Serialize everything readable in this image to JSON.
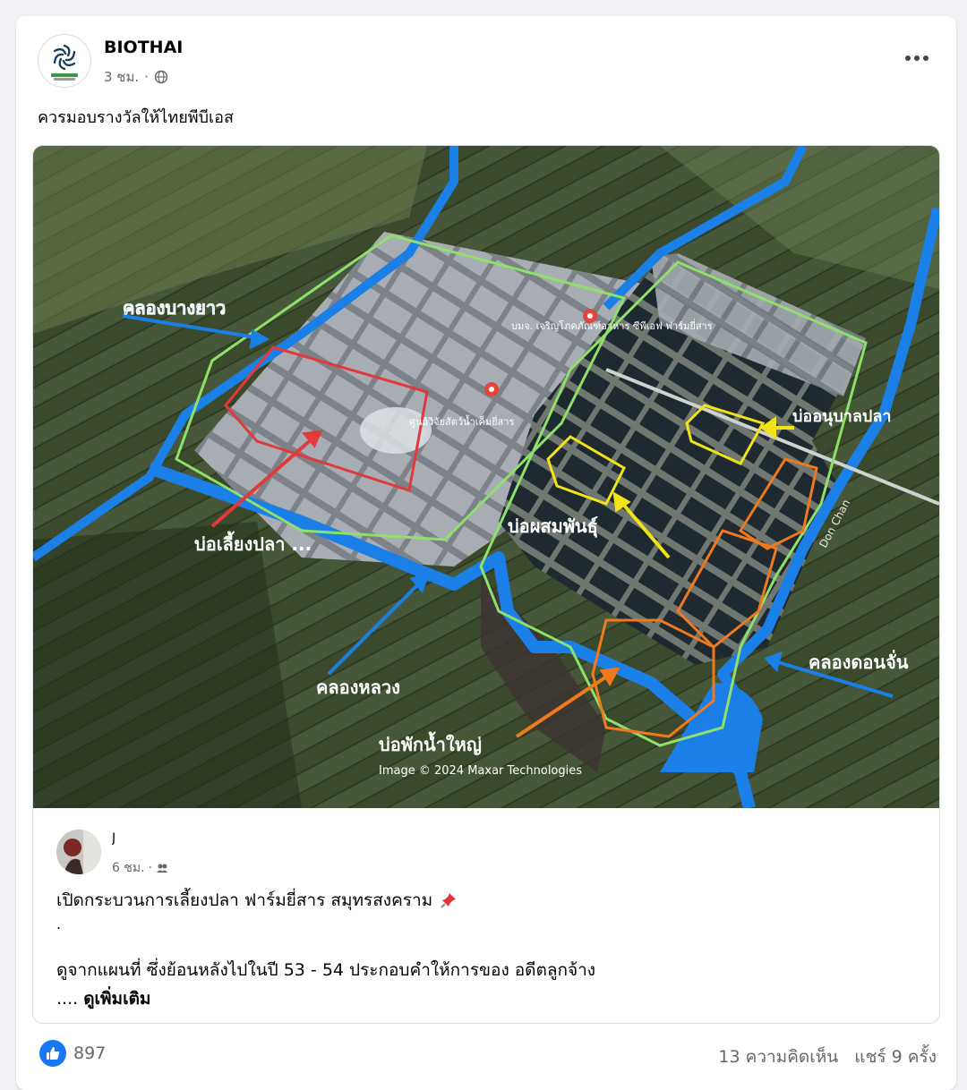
{
  "post": {
    "page_name": "BIOTHAI",
    "time": "3 ชม.",
    "privacy_icon": "globe-icon",
    "more_icon": "more-options-icon",
    "text": "ควรมอบรางวัลให้ไทยพีบีเอส"
  },
  "map": {
    "labels": {
      "khlong_bang_yao": "คลองบางยาว",
      "khlong_luang": "คลองหลวง",
      "khlong_don_chan": "คลองดอนจั่น",
      "bo_liang_pla": "บ่อเลี้ยงปลา ...",
      "bo_phasom": "บ่อผสมพันธุ์",
      "bo_onuban": "บ่ออนุบาลปลา",
      "bo_phak_nam": "บ่อพักน้ำใหญ่",
      "poi_1": "บมจ. เจริญโภคภัณฑ์อาหาร ซีพีเอฟ ฟาร์มยี่สาร",
      "poi_2": "ศูนย์วิจัยสัตว์น้ำเค็มยี่สาร",
      "road": "Don Chan",
      "credit": "Image © 2024 Maxar Technologies"
    },
    "colors": {
      "water": "#1a7fe6",
      "farm_boundary": "#8ee06a",
      "breeding_outline": "#e23a3a",
      "nursery_outline": "#f2e218",
      "reservoir_outline": "#ef7a1e"
    }
  },
  "shared_post": {
    "time": "6 ชม.",
    "privacy_icon": "friends-icon",
    "name_visible": "J",
    "line1": "เปิดกระบวนการเลี้ยงปลา ฟาร์มยี่สาร สมุทรสงคราม",
    "pin_icon": "pushpin-icon",
    "line_dot": ".",
    "line2": "ดูจากแผนที่  ซึ่งย้อนหลังไปในปี 53 - 54 ประกอบคำให้การของ อดีตลูกจ้าง",
    "line3_prefix": ".... ",
    "see_more": "ดูเพิ่มเติม"
  },
  "stats": {
    "likes": "897",
    "comments": "13 ความคิดเห็น",
    "shares": "แชร์ 9 ครั้ง"
  }
}
